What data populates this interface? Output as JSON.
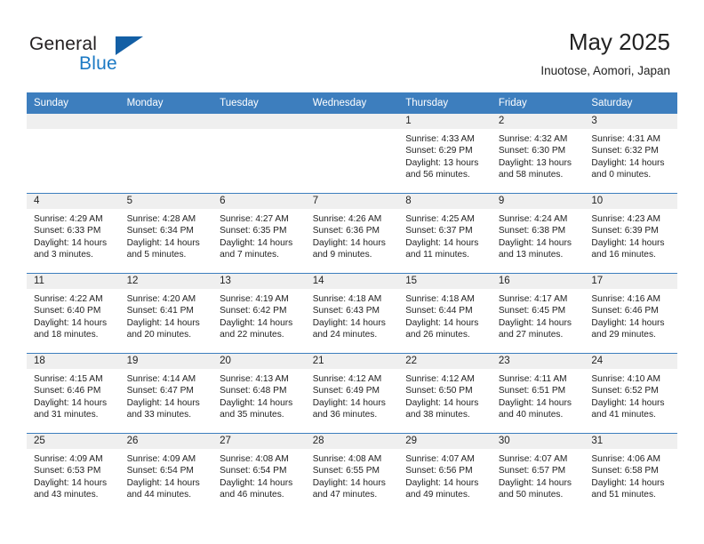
{
  "brand": {
    "word_general": "General",
    "word_blue": "Blue",
    "flag_icon": "triangle-flag-icon"
  },
  "header": {
    "title": "May 2025",
    "subtitle": "Inuotose, Aomori, Japan"
  },
  "colors": {
    "header_blue": "#3d7ebe",
    "brand_blue": "#1b79c4",
    "flag_blue": "#135fa5",
    "daynum_band": "#efefef",
    "text": "#232323"
  },
  "weekday_headers": [
    "Sunday",
    "Monday",
    "Tuesday",
    "Wednesday",
    "Thursday",
    "Friday",
    "Saturday"
  ],
  "weeks": [
    [
      {
        "day": "",
        "blank": true,
        "sunrise": "",
        "sunset": "",
        "daylight_line1": "",
        "daylight_line2": ""
      },
      {
        "day": "",
        "blank": true,
        "sunrise": "",
        "sunset": "",
        "daylight_line1": "",
        "daylight_line2": ""
      },
      {
        "day": "",
        "blank": true,
        "sunrise": "",
        "sunset": "",
        "daylight_line1": "",
        "daylight_line2": ""
      },
      {
        "day": "",
        "blank": true,
        "sunrise": "",
        "sunset": "",
        "daylight_line1": "",
        "daylight_line2": ""
      },
      {
        "day": "1",
        "blank": false,
        "sunrise": "Sunrise: 4:33 AM",
        "sunset": "Sunset: 6:29 PM",
        "daylight_line1": "Daylight: 13 hours",
        "daylight_line2": "and 56 minutes."
      },
      {
        "day": "2",
        "blank": false,
        "sunrise": "Sunrise: 4:32 AM",
        "sunset": "Sunset: 6:30 PM",
        "daylight_line1": "Daylight: 13 hours",
        "daylight_line2": "and 58 minutes."
      },
      {
        "day": "3",
        "blank": false,
        "sunrise": "Sunrise: 4:31 AM",
        "sunset": "Sunset: 6:32 PM",
        "daylight_line1": "Daylight: 14 hours",
        "daylight_line2": "and 0 minutes."
      }
    ],
    [
      {
        "day": "4",
        "blank": false,
        "sunrise": "Sunrise: 4:29 AM",
        "sunset": "Sunset: 6:33 PM",
        "daylight_line1": "Daylight: 14 hours",
        "daylight_line2": "and 3 minutes."
      },
      {
        "day": "5",
        "blank": false,
        "sunrise": "Sunrise: 4:28 AM",
        "sunset": "Sunset: 6:34 PM",
        "daylight_line1": "Daylight: 14 hours",
        "daylight_line2": "and 5 minutes."
      },
      {
        "day": "6",
        "blank": false,
        "sunrise": "Sunrise: 4:27 AM",
        "sunset": "Sunset: 6:35 PM",
        "daylight_line1": "Daylight: 14 hours",
        "daylight_line2": "and 7 minutes."
      },
      {
        "day": "7",
        "blank": false,
        "sunrise": "Sunrise: 4:26 AM",
        "sunset": "Sunset: 6:36 PM",
        "daylight_line1": "Daylight: 14 hours",
        "daylight_line2": "and 9 minutes."
      },
      {
        "day": "8",
        "blank": false,
        "sunrise": "Sunrise: 4:25 AM",
        "sunset": "Sunset: 6:37 PM",
        "daylight_line1": "Daylight: 14 hours",
        "daylight_line2": "and 11 minutes."
      },
      {
        "day": "9",
        "blank": false,
        "sunrise": "Sunrise: 4:24 AM",
        "sunset": "Sunset: 6:38 PM",
        "daylight_line1": "Daylight: 14 hours",
        "daylight_line2": "and 13 minutes."
      },
      {
        "day": "10",
        "blank": false,
        "sunrise": "Sunrise: 4:23 AM",
        "sunset": "Sunset: 6:39 PM",
        "daylight_line1": "Daylight: 14 hours",
        "daylight_line2": "and 16 minutes."
      }
    ],
    [
      {
        "day": "11",
        "blank": false,
        "sunrise": "Sunrise: 4:22 AM",
        "sunset": "Sunset: 6:40 PM",
        "daylight_line1": "Daylight: 14 hours",
        "daylight_line2": "and 18 minutes."
      },
      {
        "day": "12",
        "blank": false,
        "sunrise": "Sunrise: 4:20 AM",
        "sunset": "Sunset: 6:41 PM",
        "daylight_line1": "Daylight: 14 hours",
        "daylight_line2": "and 20 minutes."
      },
      {
        "day": "13",
        "blank": false,
        "sunrise": "Sunrise: 4:19 AM",
        "sunset": "Sunset: 6:42 PM",
        "daylight_line1": "Daylight: 14 hours",
        "daylight_line2": "and 22 minutes."
      },
      {
        "day": "14",
        "blank": false,
        "sunrise": "Sunrise: 4:18 AM",
        "sunset": "Sunset: 6:43 PM",
        "daylight_line1": "Daylight: 14 hours",
        "daylight_line2": "and 24 minutes."
      },
      {
        "day": "15",
        "blank": false,
        "sunrise": "Sunrise: 4:18 AM",
        "sunset": "Sunset: 6:44 PM",
        "daylight_line1": "Daylight: 14 hours",
        "daylight_line2": "and 26 minutes."
      },
      {
        "day": "16",
        "blank": false,
        "sunrise": "Sunrise: 4:17 AM",
        "sunset": "Sunset: 6:45 PM",
        "daylight_line1": "Daylight: 14 hours",
        "daylight_line2": "and 27 minutes."
      },
      {
        "day": "17",
        "blank": false,
        "sunrise": "Sunrise: 4:16 AM",
        "sunset": "Sunset: 6:46 PM",
        "daylight_line1": "Daylight: 14 hours",
        "daylight_line2": "and 29 minutes."
      }
    ],
    [
      {
        "day": "18",
        "blank": false,
        "sunrise": "Sunrise: 4:15 AM",
        "sunset": "Sunset: 6:46 PM",
        "daylight_line1": "Daylight: 14 hours",
        "daylight_line2": "and 31 minutes."
      },
      {
        "day": "19",
        "blank": false,
        "sunrise": "Sunrise: 4:14 AM",
        "sunset": "Sunset: 6:47 PM",
        "daylight_line1": "Daylight: 14 hours",
        "daylight_line2": "and 33 minutes."
      },
      {
        "day": "20",
        "blank": false,
        "sunrise": "Sunrise: 4:13 AM",
        "sunset": "Sunset: 6:48 PM",
        "daylight_line1": "Daylight: 14 hours",
        "daylight_line2": "and 35 minutes."
      },
      {
        "day": "21",
        "blank": false,
        "sunrise": "Sunrise: 4:12 AM",
        "sunset": "Sunset: 6:49 PM",
        "daylight_line1": "Daylight: 14 hours",
        "daylight_line2": "and 36 minutes."
      },
      {
        "day": "22",
        "blank": false,
        "sunrise": "Sunrise: 4:12 AM",
        "sunset": "Sunset: 6:50 PM",
        "daylight_line1": "Daylight: 14 hours",
        "daylight_line2": "and 38 minutes."
      },
      {
        "day": "23",
        "blank": false,
        "sunrise": "Sunrise: 4:11 AM",
        "sunset": "Sunset: 6:51 PM",
        "daylight_line1": "Daylight: 14 hours",
        "daylight_line2": "and 40 minutes."
      },
      {
        "day": "24",
        "blank": false,
        "sunrise": "Sunrise: 4:10 AM",
        "sunset": "Sunset: 6:52 PM",
        "daylight_line1": "Daylight: 14 hours",
        "daylight_line2": "and 41 minutes."
      }
    ],
    [
      {
        "day": "25",
        "blank": false,
        "sunrise": "Sunrise: 4:09 AM",
        "sunset": "Sunset: 6:53 PM",
        "daylight_line1": "Daylight: 14 hours",
        "daylight_line2": "and 43 minutes."
      },
      {
        "day": "26",
        "blank": false,
        "sunrise": "Sunrise: 4:09 AM",
        "sunset": "Sunset: 6:54 PM",
        "daylight_line1": "Daylight: 14 hours",
        "daylight_line2": "and 44 minutes."
      },
      {
        "day": "27",
        "blank": false,
        "sunrise": "Sunrise: 4:08 AM",
        "sunset": "Sunset: 6:54 PM",
        "daylight_line1": "Daylight: 14 hours",
        "daylight_line2": "and 46 minutes."
      },
      {
        "day": "28",
        "blank": false,
        "sunrise": "Sunrise: 4:08 AM",
        "sunset": "Sunset: 6:55 PM",
        "daylight_line1": "Daylight: 14 hours",
        "daylight_line2": "and 47 minutes."
      },
      {
        "day": "29",
        "blank": false,
        "sunrise": "Sunrise: 4:07 AM",
        "sunset": "Sunset: 6:56 PM",
        "daylight_line1": "Daylight: 14 hours",
        "daylight_line2": "and 49 minutes."
      },
      {
        "day": "30",
        "blank": false,
        "sunrise": "Sunrise: 4:07 AM",
        "sunset": "Sunset: 6:57 PM",
        "daylight_line1": "Daylight: 14 hours",
        "daylight_line2": "and 50 minutes."
      },
      {
        "day": "31",
        "blank": false,
        "sunrise": "Sunrise: 4:06 AM",
        "sunset": "Sunset: 6:58 PM",
        "daylight_line1": "Daylight: 14 hours",
        "daylight_line2": "and 51 minutes."
      }
    ]
  ]
}
